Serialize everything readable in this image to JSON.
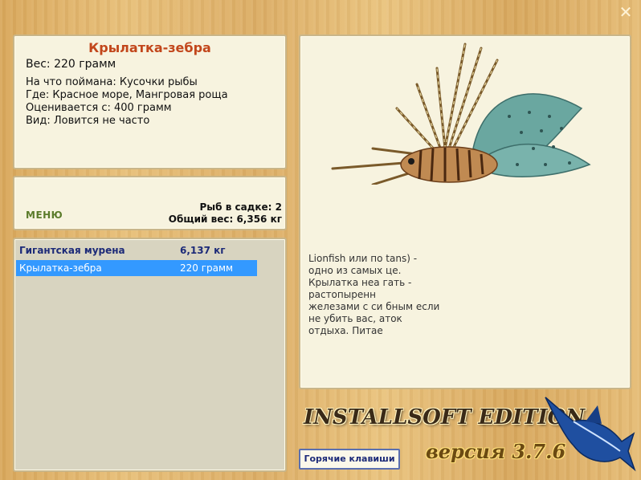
{
  "window": {
    "close_glyph": "✕"
  },
  "fish": {
    "title": "Крылатка-зебра",
    "weight": "Вес: 220 грамм",
    "caught_on": "На что поймана: Кусочки рыбы",
    "where": "Где: Красное море, Мангровая роща",
    "valued_from": "Оценивается с: 400 грамм",
    "kind": "Вид: Ловится не часто"
  },
  "stats": {
    "menu_label": "МЕНЮ",
    "fish_in_net": "Рыб в садке: 2",
    "total_weight": "Общий вес: 6,356 кг"
  },
  "catch_list": [
    {
      "name": "Гигантская мурена",
      "weight": "6,137 кг",
      "selected": false
    },
    {
      "name": "Крылатка-зебра",
      "weight": "220 грамм",
      "selected": true
    }
  ],
  "description": {
    "lines": [
      "Lionfish или по                                    tans) -",
      "одно из самых                                      це.",
      "Крылатка неа                                       гать -",
      "растопыренн                                         ",
      "железами с си                                    бным если",
      "не убить вас,                                     аток",
      "отдыха. Питае"
    ]
  },
  "branding": {
    "edition": "INSTALLSOFT EDITION",
    "version": "версия 3.7.6"
  },
  "buttons": {
    "hotkeys": "Горячие клавиши"
  },
  "colors": {
    "title": "#c2461b",
    "selection": "#3399ff",
    "list_bold": "#1c2a78"
  }
}
